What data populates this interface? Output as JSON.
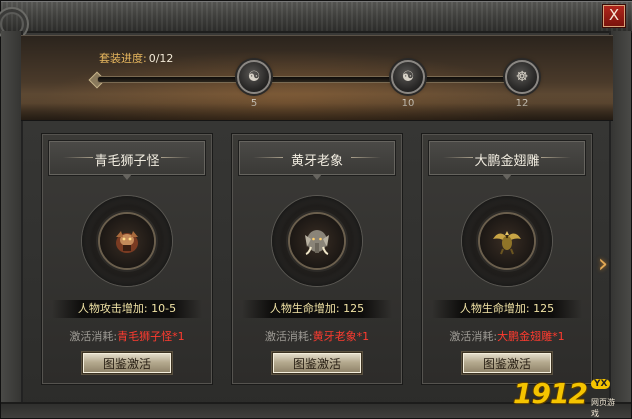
{
  "window": {
    "close_label": "X"
  },
  "progress": {
    "label": "套装进度:",
    "value": "0/12",
    "fraction": 0,
    "milestones": [
      {
        "count": "5",
        "icon": "compass-icon",
        "glyph": "☯"
      },
      {
        "count": "10",
        "icon": "yin-yang-icon",
        "glyph": "☯"
      },
      {
        "count": "12",
        "icon": "beast-icon",
        "glyph": "☸"
      }
    ]
  },
  "cards": [
    {
      "title": "青毛狮子怪",
      "portrait_icon": "green-lion-demon-portrait",
      "stat": "人物攻击增加: 10-5",
      "cost_label": "激活消耗:",
      "cost_value": "青毛狮子怪*1",
      "button": "图鉴激活"
    },
    {
      "title": "黄牙老象",
      "portrait_icon": "yellow-tusk-elephant-portrait",
      "stat": "人物生命增加: 125",
      "cost_label": "激活消耗:",
      "cost_value": "黄牙老象*1",
      "button": "图鉴激活"
    },
    {
      "title": "大鹏金翅雕",
      "portrait_icon": "golden-roc-portrait",
      "stat": "人物生命增加: 125",
      "cost_label": "激活消耗:",
      "cost_value": "大鹏金翅雕*1",
      "button": "图鉴激活"
    }
  ],
  "next_arrow": "›",
  "watermark": {
    "number": "1912",
    "badge": "YX",
    "subtitle": "网页游戏"
  },
  "colors": {
    "accent_gold": "#e7b75e",
    "cost_red": "#ff3b2f",
    "stat_yellow": "#f2e4a6"
  }
}
